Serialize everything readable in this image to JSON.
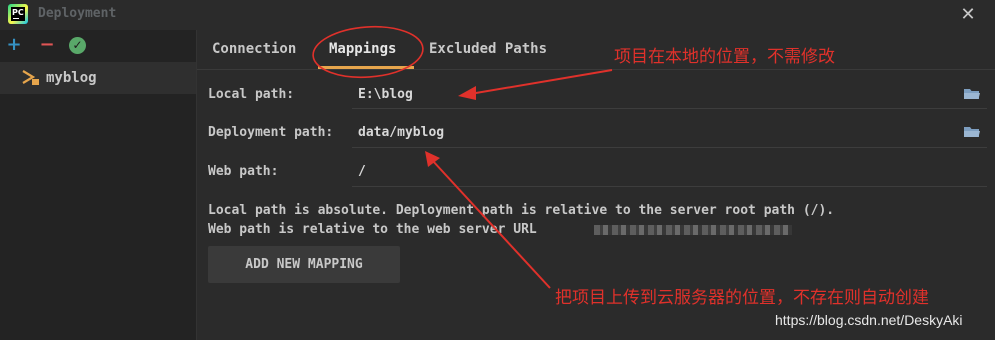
{
  "window": {
    "title": "Deployment",
    "close_icon": "close-icon"
  },
  "sidebar": {
    "toolbar": {
      "add_icon": "plus-icon",
      "remove_icon": "minus-icon",
      "default_icon": "check-icon"
    },
    "servers": [
      {
        "label": "myblog",
        "icon": "sftp-server-icon"
      }
    ]
  },
  "tabs": [
    {
      "label": "Connection",
      "selected": false
    },
    {
      "label": "Mappings",
      "selected": true
    },
    {
      "label": "Excluded Paths",
      "selected": false
    }
  ],
  "mappings": {
    "local_path_label": "Local path:",
    "local_path_value": "E:\\blog",
    "deployment_path_label": "Deployment path:",
    "deployment_path_value": "data/myblog",
    "web_path_label": "Web path:",
    "web_path_value": "/",
    "info_line1": "Local path is absolute. Deployment path is relative to the server root path (/).",
    "info_line2": "Web path is relative to the web server URL",
    "add_button": "ADD NEW MAPPING"
  },
  "annotations": {
    "top": "项目在本地的位置，不需修改",
    "bottom": "把项目上传到云服务器的位置，不存在则自动创建",
    "color": "#e0312b"
  },
  "watermark": "https://blog.csdn.net/DeskyAki",
  "colors": {
    "accent_underline": "#e6a54c",
    "plus": "#3592c4",
    "minus": "#e05555",
    "check": "#59a869",
    "folder": "#7d9ec0"
  }
}
